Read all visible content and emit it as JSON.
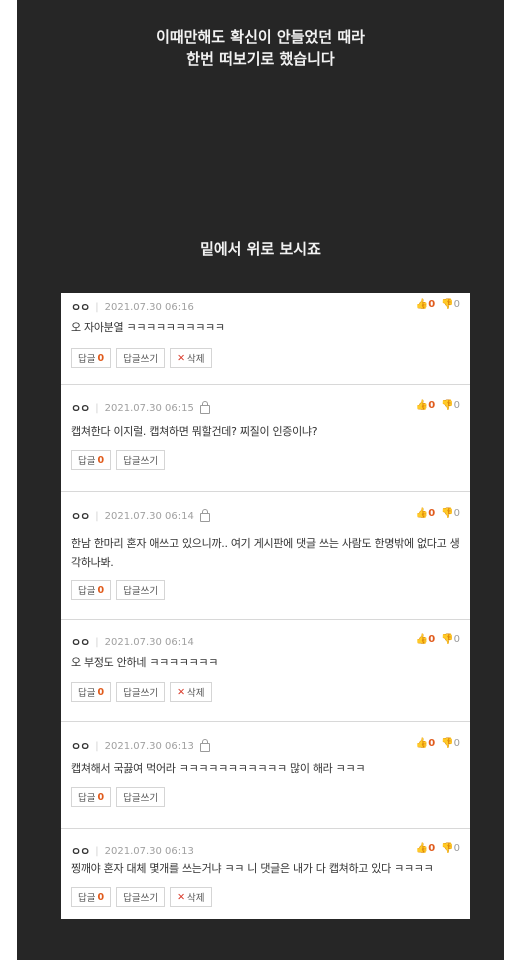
{
  "header": {
    "line1": "이때만해도 확신이 안들었던 때라",
    "line2": "한번 떠보기로 했습니다",
    "sub": "밑에서 위로 보시죠"
  },
  "buttons": {
    "reply_label": "답글",
    "write_label": "답글쓰기",
    "delete_label": "삭제",
    "delete_icon": "✕"
  },
  "comments": [
    {
      "author": "ㅇㅇ",
      "date": "2021.07.30 06:16",
      "locked": false,
      "text": "오 자아분열 ㅋㅋㅋㅋㅋㅋㅋㅋㅋㅋ",
      "up": "0",
      "down": "0",
      "replies": "0",
      "deletable": true
    },
    {
      "author": "ㅇㅇ",
      "date": "2021.07.30 06:15",
      "locked": true,
      "text": "캡쳐한다 이지럴. 캡쳐하면 뭐할건데? 찌질이 인증이냐?",
      "up": "0",
      "down": "0",
      "replies": "0",
      "deletable": false
    },
    {
      "author": "ㅇㅇ",
      "date": "2021.07.30 06:14",
      "locked": true,
      "text": "한남 한마리 혼자 애쓰고 있으니까.. 여기 게시판에 댓글 쓰는 사람도 한명밖에 없다고 생각하나봐.",
      "up": "0",
      "down": "0",
      "replies": "0",
      "deletable": false
    },
    {
      "author": "ㅇㅇ",
      "date": "2021.07.30 06:14",
      "locked": false,
      "text": "오 부정도 안하네 ㅋㅋㅋㅋㅋㅋㅋ",
      "up": "0",
      "down": "0",
      "replies": "0",
      "deletable": true
    },
    {
      "author": "ㅇㅇ",
      "date": "2021.07.30 06:13",
      "locked": true,
      "text": "캡쳐해서 국끓여 먹어라 ㅋㅋㅋㅋㅋㅋㅋㅋㅋㅋㅋ 많이 해라 ㅋㅋㅋ",
      "up": "0",
      "down": "0",
      "replies": "0",
      "deletable": false
    },
    {
      "author": "ㅇㅇ",
      "date": "2021.07.30 06:13",
      "locked": false,
      "text": "찡깨야 혼자 대체 몇개를 쓰는거냐 ㅋㅋ 니 댓글은 내가 다 캡쳐하고 있다 ㅋㅋㅋㅋ",
      "up": "0",
      "down": "0",
      "replies": "0",
      "deletable": true
    }
  ]
}
